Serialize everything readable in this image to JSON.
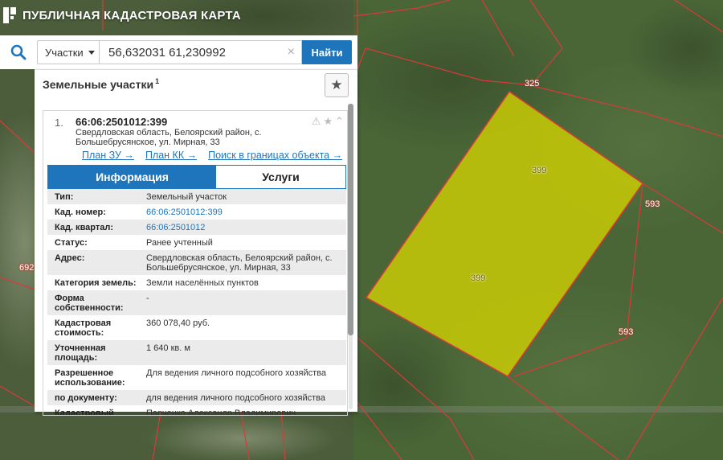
{
  "app": {
    "title": "ПУБЛИЧНАЯ КАДАСТРОВАЯ КАРТА"
  },
  "search": {
    "type_label": "Участки",
    "query": "56,632031 61,230992",
    "clear_symbol": "×",
    "find_label": "Найти"
  },
  "panel": {
    "title": "Земельные участки",
    "count": "1",
    "favorite_symbol": "★"
  },
  "card": {
    "index": "1.",
    "cadastral_number": "66:06:2501012:399",
    "address": "Свердловская область, Белоярский район, с. Большебрусянское, ул. Мирная, 33",
    "links": [
      "План ЗУ →",
      "План КК →",
      "Поиск в границах объекта →"
    ],
    "tools": [
      "⚠",
      "★",
      "⌃"
    ],
    "tabs": [
      {
        "label": "Информация",
        "active": true
      },
      {
        "label": "Услуги",
        "active": false
      }
    ]
  },
  "attributes": [
    {
      "label": "Тип:",
      "value": "Земельный участок",
      "link": false
    },
    {
      "label": "Кад. номер:",
      "value": "66:06:2501012:399",
      "link": true
    },
    {
      "label": "Кад. квартал:",
      "value": "66:06:2501012",
      "link": true
    },
    {
      "label": "Статус:",
      "value": "Ранее учтенный",
      "link": false
    },
    {
      "label": "Адрес:",
      "value": "Свердловская область, Белоярский район, с. Большебрусянское, ул. Мирная, 33",
      "link": false
    },
    {
      "label": "Категория земель:",
      "value": "Земли населённых пунктов",
      "link": false
    },
    {
      "label": "Форма собственности:",
      "value": "-",
      "link": false
    },
    {
      "label": "Кадастровая стоимость:",
      "value": "360 078,40 руб.",
      "link": false
    },
    {
      "label": "Уточненная площадь:",
      "value": "1 640 кв. м",
      "link": false
    },
    {
      "label": "Разрешенное использование:",
      "value": "Для ведения личного подсобного хозяйства",
      "link": false
    },
    {
      "label": "по документу:",
      "value": "для ведения личного подсобного хозяйства",
      "link": false
    },
    {
      "label": "Кадастровый",
      "value": "Парченко Александр Владимирович",
      "link": false
    }
  ],
  "map": {
    "plot_labels": [
      "399",
      "399",
      "325",
      "593",
      "593",
      "692"
    ],
    "colors": {
      "plot_fill": "#d4d400",
      "boundary": "#d93a3a",
      "accent": "#1f75bc"
    }
  }
}
